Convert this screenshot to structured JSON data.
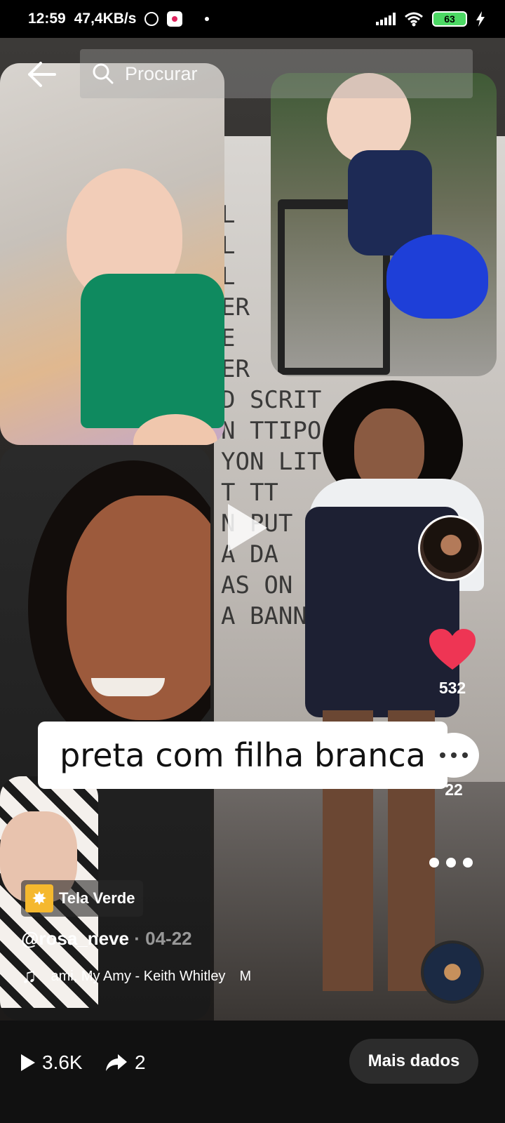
{
  "status_bar": {
    "time": "12:59",
    "speed": "47,4KB/s",
    "battery": "63",
    "icons": [
      "alarm-icon",
      "app-icon",
      "dot-icon",
      "signal-icon",
      "wifi-icon",
      "battery-icon",
      "charging-icon"
    ]
  },
  "header": {
    "back_icon": "arrow-left-icon",
    "search": {
      "placeholder": "Procurar",
      "icon": "search-icon"
    }
  },
  "video": {
    "caption": "preta com filha branca",
    "wall_text": "L\nL\nL\nER\nE\nER\nD SCRIT\nN TTIPO\nYON LIT\nT TT\nN PUT\nA DA\nAS ON\nA BANN"
  },
  "right_rail": {
    "likes": "532",
    "comments": "22",
    "like_color": "#ee3554"
  },
  "info": {
    "effect_label": "Tela Verde",
    "author": "@rosa_neve",
    "date": "· 04-22",
    "music": "ami, My Amy - Keith Whitley",
    "music_suffix": "M"
  },
  "bottom_bar": {
    "views": "3.6K",
    "shares": "2",
    "more_button": "Mais dados"
  }
}
